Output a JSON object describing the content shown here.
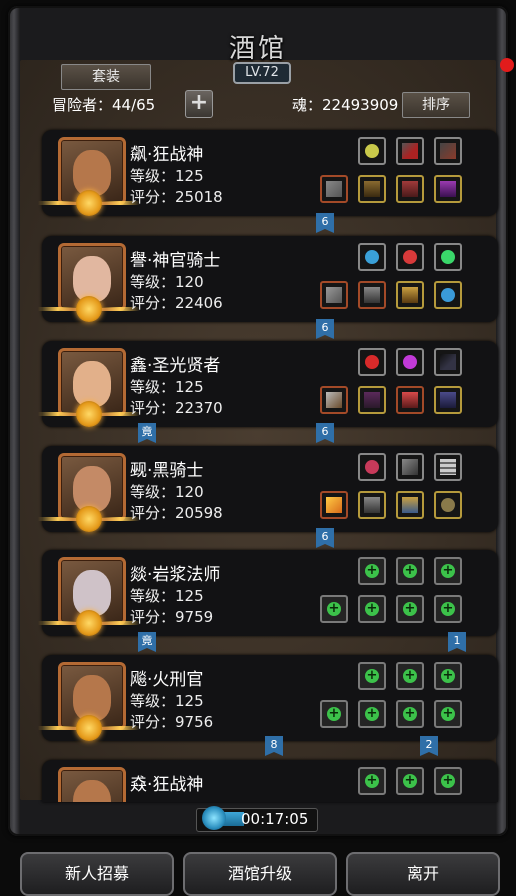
{
  "title": "酒馆",
  "level_badge": "LV.72",
  "suit_button": "套装",
  "adventurers": "冒险者：44/65",
  "soul": "魂：22493909",
  "sort_button": "排序",
  "heroes": [
    {
      "name": "飙·狂战神",
      "level": "等级：125",
      "score": "评分：25018",
      "tags": [
        "6"
      ]
    },
    {
      "name": "譽·神官骑士",
      "level": "等级：120",
      "score": "评分：22406",
      "tags": [
        "6"
      ]
    },
    {
      "name": "鑫·圣光贤者",
      "level": "等级：125",
      "score": "评分：22370",
      "tags": [
        "竟",
        "6"
      ]
    },
    {
      "name": "觋·黑骑士",
      "level": "等级：120",
      "score": "评分：20598",
      "tags": [
        "6"
      ]
    },
    {
      "name": "燚·岩浆法师",
      "level": "等级：125",
      "score": "评分：9759",
      "tags": [
        "竟",
        "1"
      ]
    },
    {
      "name": "飚·火刑官",
      "level": "等级：125",
      "score": "评分：9756",
      "tags": [
        "8",
        "2"
      ]
    },
    {
      "name": "猋·狂战神",
      "level": "",
      "score": "",
      "tags": []
    }
  ],
  "timer": "00:17:05",
  "buttons": {
    "recruit": "新人招募",
    "upgrade": "酒馆升级",
    "leave": "离开"
  },
  "colors": {
    "tag_blue": "#2f6fa8",
    "plus_green": "#3cc24a",
    "slot_gold": "#b59a3c",
    "slot_red": "#a34a28"
  }
}
